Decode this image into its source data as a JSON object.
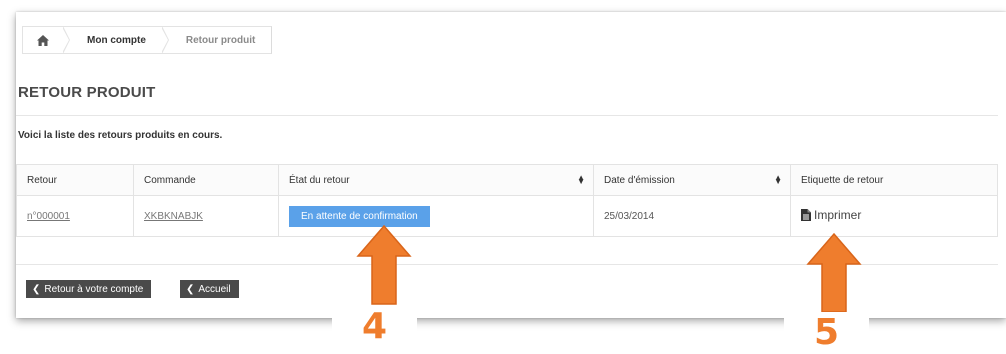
{
  "breadcrumb": {
    "items": [
      {
        "label": "Mon compte"
      },
      {
        "label": "Retour produit"
      }
    ]
  },
  "page": {
    "title": "RETOUR PRODUIT",
    "intro": "Voici la liste des retours produits en cours."
  },
  "table": {
    "headers": [
      "Retour",
      "Commande",
      "État du retour",
      "Date d'émission",
      "Etiquette de retour"
    ],
    "rows": [
      {
        "retour": "n°000001",
        "commande": "XKBKNABJK",
        "etat": "En attente de confirmation",
        "date": "25/03/2014",
        "etiquette": "Imprimer"
      }
    ]
  },
  "buttons": {
    "back_account": "Retour à votre compte",
    "home": "Accueil"
  },
  "callouts": {
    "status": "4",
    "print": "5"
  },
  "colors": {
    "status_badge": "#5aa1e9",
    "arrow": "#ef7d2d",
    "button": "#4a4a4a"
  }
}
